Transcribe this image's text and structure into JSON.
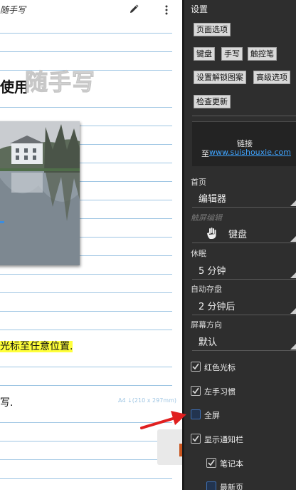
{
  "page": {
    "title": "随手写",
    "heading": "使用",
    "logo": "随手写",
    "highlight_text": "光标至任意位置.",
    "line_text": "写.",
    "paper_size": "A4 ↓(210 x 297mm)"
  },
  "drawer": {
    "title": "设置",
    "buttons": {
      "page_options": "页面选项",
      "keyboard": "键盘",
      "handwriting": "手写",
      "touch_pen": "触控笔",
      "unlock_pattern": "设置解锁图案",
      "advanced": "高级选项",
      "check_update": "检查更新"
    },
    "link": {
      "label": "链接",
      "prefix": "至",
      "url": "www.suishouxie.com"
    },
    "home": {
      "label": "首页",
      "value": "编辑器"
    },
    "touch_edit": {
      "label": "触屏编辑",
      "value": "键盘",
      "icon": "hand-icon"
    },
    "sleep": {
      "label": "休眠",
      "value": "5 分钟"
    },
    "autosave": {
      "label": "自动存盘",
      "value": "2 分钟后"
    },
    "orientation": {
      "label": "屏幕方向",
      "value": "默认"
    },
    "checkboxes": [
      {
        "label": "红色光标",
        "checked": true
      },
      {
        "label": "左手习惯",
        "checked": true
      },
      {
        "label": "全屏",
        "checked": false
      },
      {
        "label": "显示通知栏",
        "checked": true
      },
      {
        "label": "笔记本",
        "checked": true
      },
      {
        "label": "最新页",
        "checked": false
      }
    ]
  },
  "colors": {
    "drawer_bg": "#2e2e2e",
    "rule_line": "#9ec5e3",
    "link": "#3fa4ff",
    "highlight": "#ffff3b",
    "pointer_arrow": "#e02020"
  }
}
